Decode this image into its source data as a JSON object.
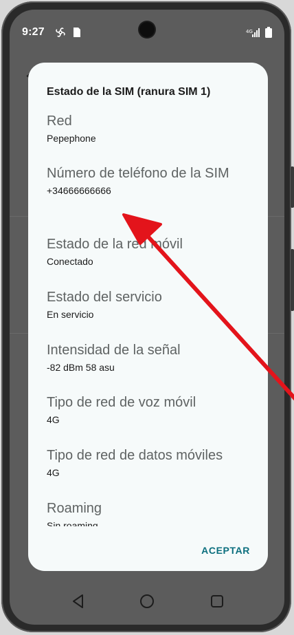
{
  "status_bar": {
    "time": "9:27"
  },
  "dialog": {
    "title": "Estado de la SIM (ranura SIM 1)",
    "items": [
      {
        "label": "Red",
        "value": "Pepephone"
      },
      {
        "label": "Número de teléfono de la SIM",
        "value": "+34666666666"
      },
      {
        "label": "Estado de la red móvil",
        "value": "Conectado"
      },
      {
        "label": "Estado del servicio",
        "value": "En servicio"
      },
      {
        "label": "Intensidad de la señal",
        "value": "-82 dBm 58 asu"
      },
      {
        "label": "Tipo de red de voz móvil",
        "value": "4G"
      },
      {
        "label": "Tipo de red de datos móviles",
        "value": "4G"
      },
      {
        "label": "Roaming",
        "value": "Sin roaming"
      }
    ],
    "accept_label": "ACEPTAR"
  },
  "nav": {
    "back": "back-icon",
    "home": "home-icon",
    "recents": "recents-icon"
  },
  "colors": {
    "accent": "#0c6f7e",
    "annotation_arrow": "#e3141b",
    "dialog_bg": "#f6fafa",
    "scrim": "#5c5c5c"
  }
}
